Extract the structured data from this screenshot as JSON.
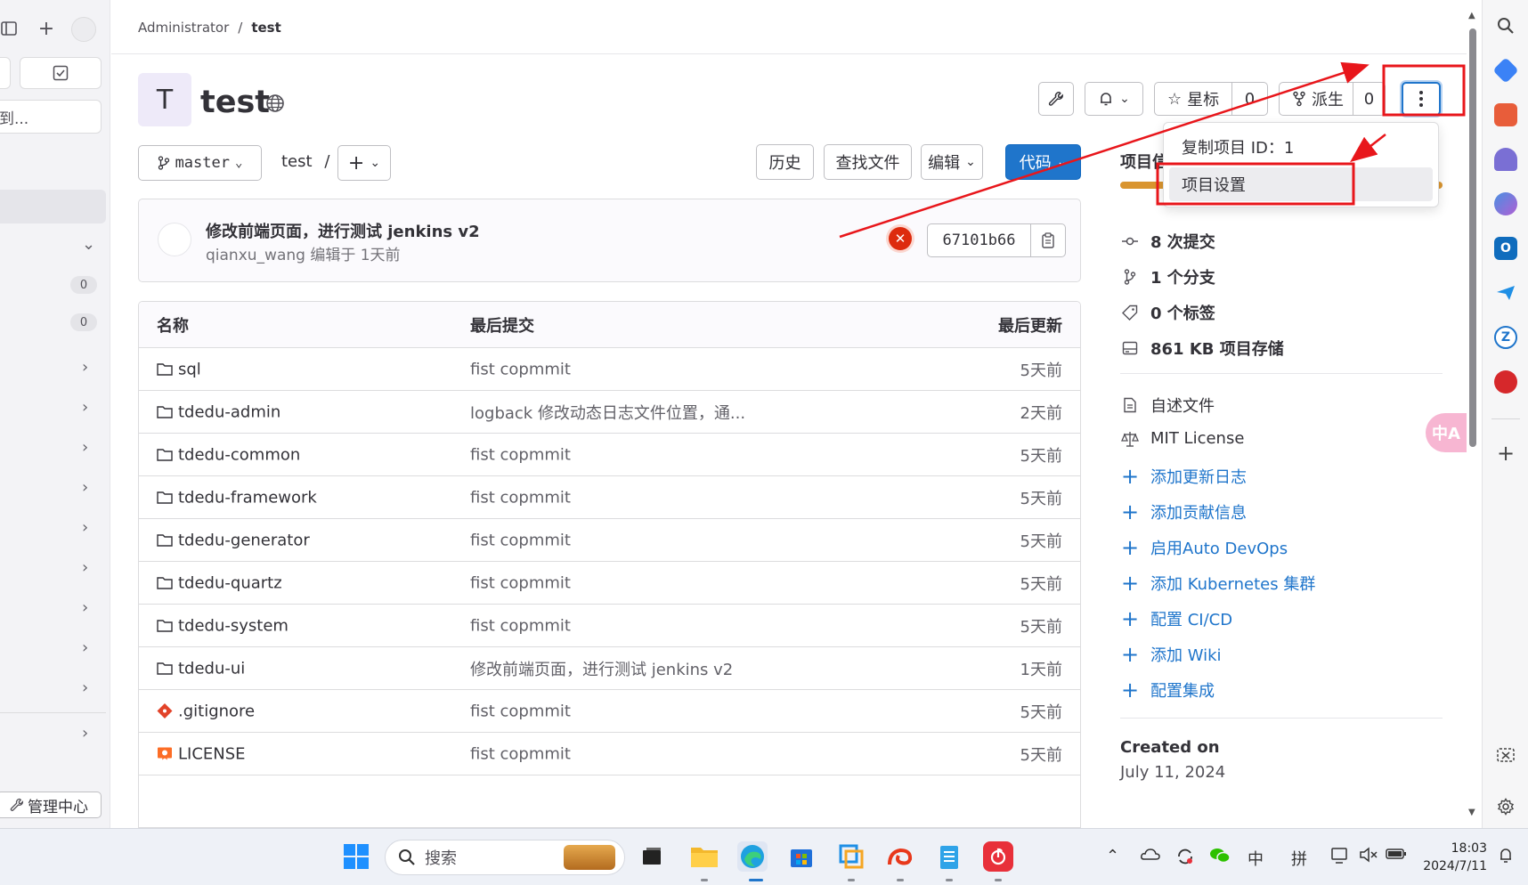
{
  "breadcrumb": {
    "parent": "Administrator",
    "separator": "/",
    "current": "test"
  },
  "project": {
    "avatar_letter": "T",
    "name": "test"
  },
  "header_buttons": {
    "star_label": "星标",
    "star_count": "0",
    "fork_label": "派生",
    "fork_count": "0"
  },
  "dropdown": {
    "copy_id": "复制项目 ID：1",
    "settings": "项目设置"
  },
  "ref_bar": {
    "branch": "master",
    "path": "test",
    "path_sep": "/",
    "add": "+"
  },
  "actions": {
    "history": "历史",
    "find_file": "查找文件",
    "edit": "编辑",
    "code": "代码"
  },
  "commit": {
    "title": "修改前端页面，进行测试 jenkins v2",
    "meta": "qianxu_wang 编辑于 1天前",
    "sha": "67101b66"
  },
  "table": {
    "headers": {
      "name": "名称",
      "last_commit": "最后提交",
      "last_update": "最后更新"
    },
    "rows": [
      {
        "name": "sql",
        "type": "folder",
        "commit": "fist copmmit",
        "time": "5天前"
      },
      {
        "name": "tdedu-admin",
        "type": "folder",
        "commit": "logback 修改动态日志文件位置，通...",
        "time": "2天前"
      },
      {
        "name": "tdedu-common",
        "type": "folder",
        "commit": "fist copmmit",
        "time": "5天前"
      },
      {
        "name": "tdedu-framework",
        "type": "folder",
        "commit": "fist copmmit",
        "time": "5天前"
      },
      {
        "name": "tdedu-generator",
        "type": "folder",
        "commit": "fist copmmit",
        "time": "5天前"
      },
      {
        "name": "tdedu-quartz",
        "type": "folder",
        "commit": "fist copmmit",
        "time": "5天前"
      },
      {
        "name": "tdedu-system",
        "type": "folder",
        "commit": "fist copmmit",
        "time": "5天前"
      },
      {
        "name": "tdedu-ui",
        "type": "folder",
        "commit": "修改前端页面，进行测试 jenkins v2",
        "time": "1天前"
      },
      {
        "name": ".gitignore",
        "type": "git-file",
        "commit": "fist copmmit",
        "time": "5天前"
      },
      {
        "name": "LICENSE",
        "type": "license-file",
        "commit": "fist copmmit",
        "time": "5天前"
      }
    ]
  },
  "info": {
    "title": "项目信",
    "stats": [
      {
        "icon": "commit-icon",
        "text": "8 次提交"
      },
      {
        "icon": "branch-icon",
        "text": "1 个分支"
      },
      {
        "icon": "tag-icon",
        "text": "0 个标签"
      },
      {
        "icon": "storage-icon",
        "text": "861 KB 项目存储"
      }
    ],
    "files": [
      {
        "icon": "readme-icon",
        "text": "自述文件"
      },
      {
        "icon": "scale-icon",
        "text": "MIT License"
      }
    ],
    "links": [
      "添加更新日志",
      "添加贡献信息",
      "启用Auto DevOps",
      "添加 Kubernetes 集群",
      "配置 CI/CD",
      "添加 Wiki",
      "配置集成"
    ],
    "created_label": "Created on",
    "created_date": "July 11, 2024"
  },
  "left_sidebar": {
    "partial_text": "到...",
    "badge1": "0",
    "badge2": "0",
    "admin": "管理中心"
  },
  "translate": "中A",
  "taskbar": {
    "search": "搜索",
    "ime_lang": "中",
    "ime_mode": "拼",
    "time": "18:03",
    "date": "2024/7/11"
  },
  "colors": {
    "primary": "#1f75cb",
    "annotation_red": "#e8161b",
    "pipeline_failed": "#dd2b0e"
  }
}
